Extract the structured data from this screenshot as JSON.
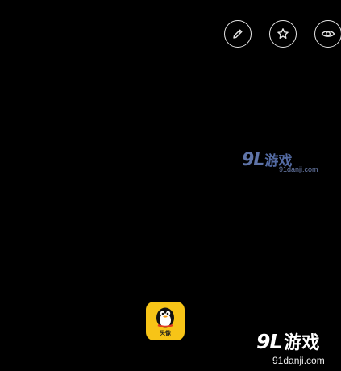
{
  "toolbar": {
    "edit_icon": "pencil-icon",
    "favorite_icon": "star-icon",
    "view_icon": "eye-icon",
    "icon_color": "#e6e6e6"
  },
  "watermark_center": {
    "number": "9L",
    "name": "游戏",
    "domain": "91danji.com"
  },
  "app_icon": {
    "label": "头像",
    "icon": "penguin-icon",
    "background": "#f7c417"
  },
  "watermark_bottom": {
    "number": "9L",
    "name": "游戏",
    "domain": "91danji.com"
  }
}
